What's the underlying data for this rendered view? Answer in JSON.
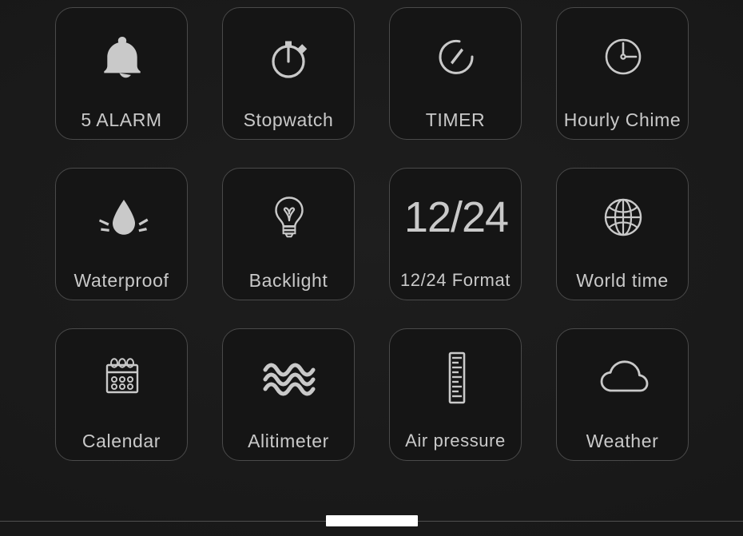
{
  "screen": {
    "background_color": "#1b1b1b",
    "tile_background_color": "#151515",
    "tile_border_color": "#4a4a4a",
    "icon_color": "#c9c9c9",
    "label_color": "#c9c9c9"
  },
  "tiles": [
    {
      "icon": "bell-icon",
      "label": "5 ALARM"
    },
    {
      "icon": "stopwatch-icon",
      "label": "Stopwatch"
    },
    {
      "icon": "timer-icon",
      "label": "TIMER"
    },
    {
      "icon": "clock-icon",
      "label": "Hourly Chime"
    },
    {
      "icon": "water-drop-icon",
      "label": "Waterproof"
    },
    {
      "icon": "lightbulb-icon",
      "label": "Backlight"
    },
    {
      "icon": "12-24-text-icon",
      "label": "12/24 Format",
      "icon_text": "12/24"
    },
    {
      "icon": "globe-icon",
      "label": "World time"
    },
    {
      "icon": "calendar-icon",
      "label": "Calendar"
    },
    {
      "icon": "waves-icon",
      "label": "Alitimeter"
    },
    {
      "icon": "ruler-icon",
      "label": "Air pressure"
    },
    {
      "icon": "cloud-icon",
      "label": "Weather"
    }
  ],
  "system_bar": {
    "home_indicator": "home-indicator-bar"
  }
}
